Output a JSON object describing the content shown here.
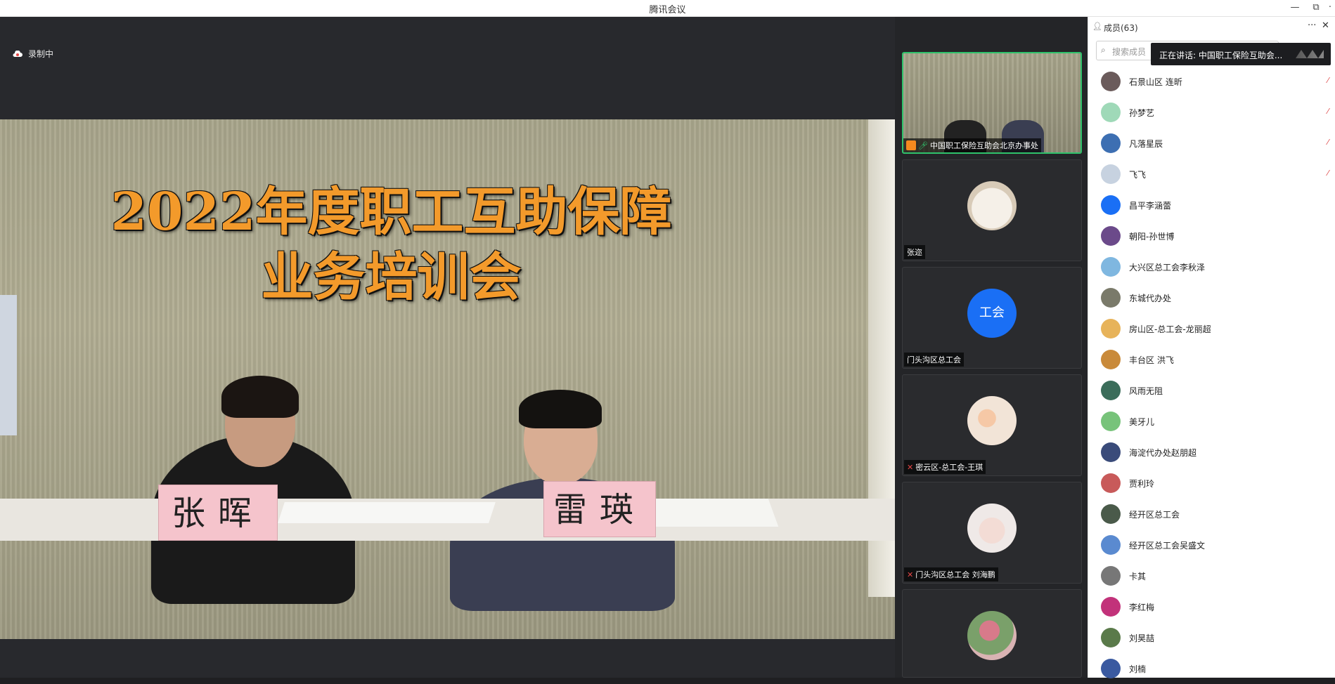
{
  "window": {
    "title": "腾讯会议",
    "minimize": "—",
    "restore": "⧉",
    "close": "✕"
  },
  "stage": {
    "recording": "录制中",
    "banner_line1": "2022年度职工互助保障",
    "banner_line2": "业务培训会",
    "nameplate_left": "张晖",
    "nameplate_right": "雷瑛"
  },
  "tiles": [
    {
      "name": "中国职工保险互助会北京办事处",
      "avatar_color": "#8a8a72"
    },
    {
      "name": "张迩",
      "avatar_color": "#efe7dc"
    },
    {
      "name": "门头沟区总工会",
      "avatar_text": "工会",
      "avatar_color": "#1a6ff5"
    },
    {
      "name": "密云区-总工会-王琪",
      "avatar_color": "#f2e4d7"
    },
    {
      "name": "门头沟区总工会 刘海鹏",
      "avatar_color": "#efe9e7"
    },
    {
      "name": "",
      "avatar_color": "#d9b3b3"
    }
  ],
  "members": {
    "title": "成员(63)",
    "more": "···",
    "close": "✕",
    "search_placeholder": "搜索成员",
    "speaking": "正在讲话: 中国职工保险互助会...",
    "list": [
      {
        "name": "石景山区 连昕",
        "color": "#6b5b5b"
      },
      {
        "name": "孙梦艺",
        "color": "#9fd9b8"
      },
      {
        "name": "凡落星辰",
        "color": "#3d6fb2"
      },
      {
        "name": "飞飞",
        "color": "#c7d2e0"
      },
      {
        "name": "昌平李涵蕾",
        "color": "#1a6ff5"
      },
      {
        "name": "朝阳-孙世博",
        "color": "#6b4a8a"
      },
      {
        "name": "大兴区总工会李秋泽",
        "color": "#7fb7e0"
      },
      {
        "name": "东城代办处",
        "color": "#7a7a6a"
      },
      {
        "name": "房山区-总工会-龙丽超",
        "color": "#e7b35a"
      },
      {
        "name": "丰台区 洪飞",
        "color": "#c98a3a"
      },
      {
        "name": "风雨无阻",
        "color": "#3b6d5a"
      },
      {
        "name": "美牙儿",
        "color": "#77c37a"
      },
      {
        "name": "海淀代办处赵朋超",
        "color": "#3a4b7a"
      },
      {
        "name": "贾利玲",
        "color": "#c85a5a"
      },
      {
        "name": "经开区总工会",
        "color": "#4a5a4a"
      },
      {
        "name": "经开区总工会吴盛文",
        "color": "#5a8ad0"
      },
      {
        "name": "卡其",
        "color": "#777777"
      },
      {
        "name": "李红梅",
        "color": "#c2327a"
      },
      {
        "name": "刘昊喆",
        "color": "#5a7a4a"
      },
      {
        "name": "刘楠",
        "color": "#3a5aa0"
      }
    ]
  }
}
